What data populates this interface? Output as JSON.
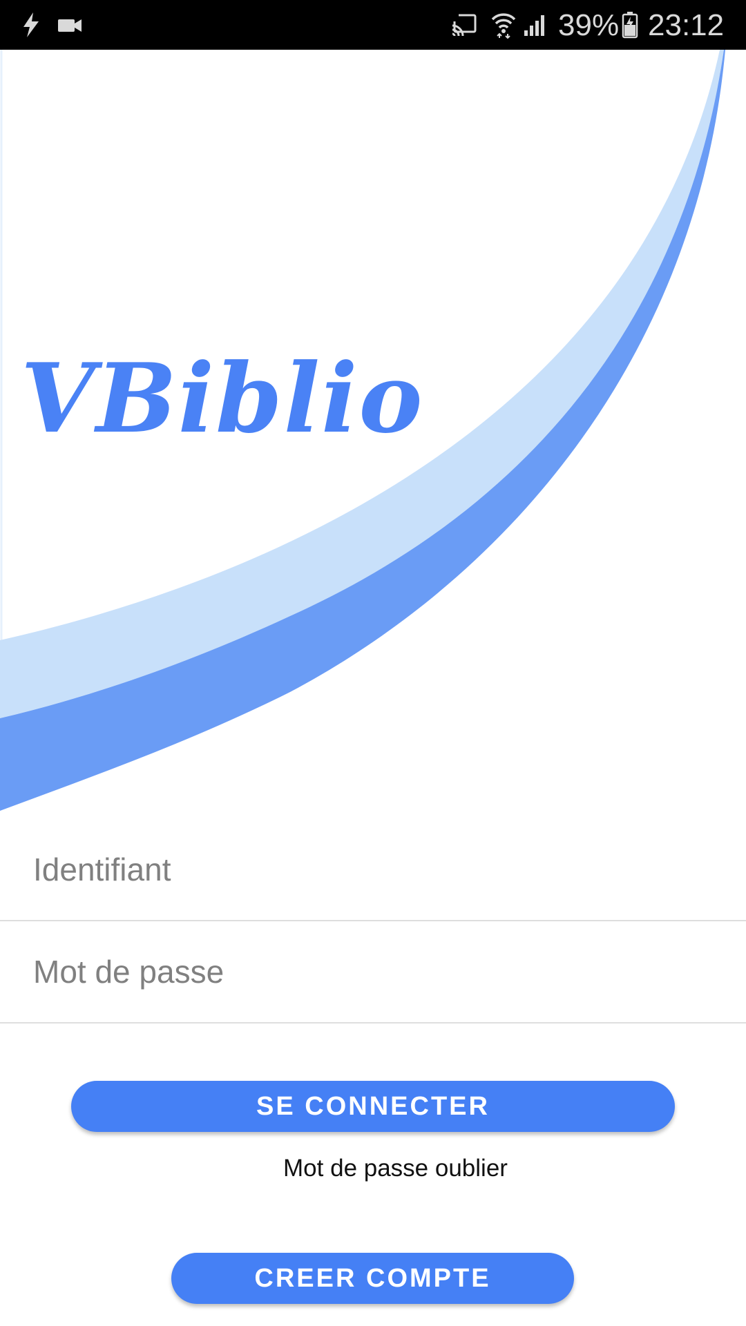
{
  "status_bar": {
    "left_icons": [
      "flash-icon",
      "video-camera-icon"
    ],
    "right_icons": [
      "cast-icon",
      "wifi-icon",
      "signal-icon",
      "battery-icon"
    ],
    "battery_percent": "39%",
    "time": "23:12"
  },
  "header": {
    "logo_text": "VBiblio",
    "colors": {
      "logo": "#4a82f5",
      "wave_light": "#c8e0fa",
      "wave_dark": "#6a9cf5"
    }
  },
  "form": {
    "username": {
      "placeholder": "Identifiant",
      "value": ""
    },
    "password": {
      "placeholder": "Mot de passe",
      "value": ""
    }
  },
  "actions": {
    "login_label": "SE CONNECTER",
    "forgot_label": "Mot de passe oublier",
    "create_account_label": "CREER COMPTE",
    "accent_color": "#4580f5"
  }
}
